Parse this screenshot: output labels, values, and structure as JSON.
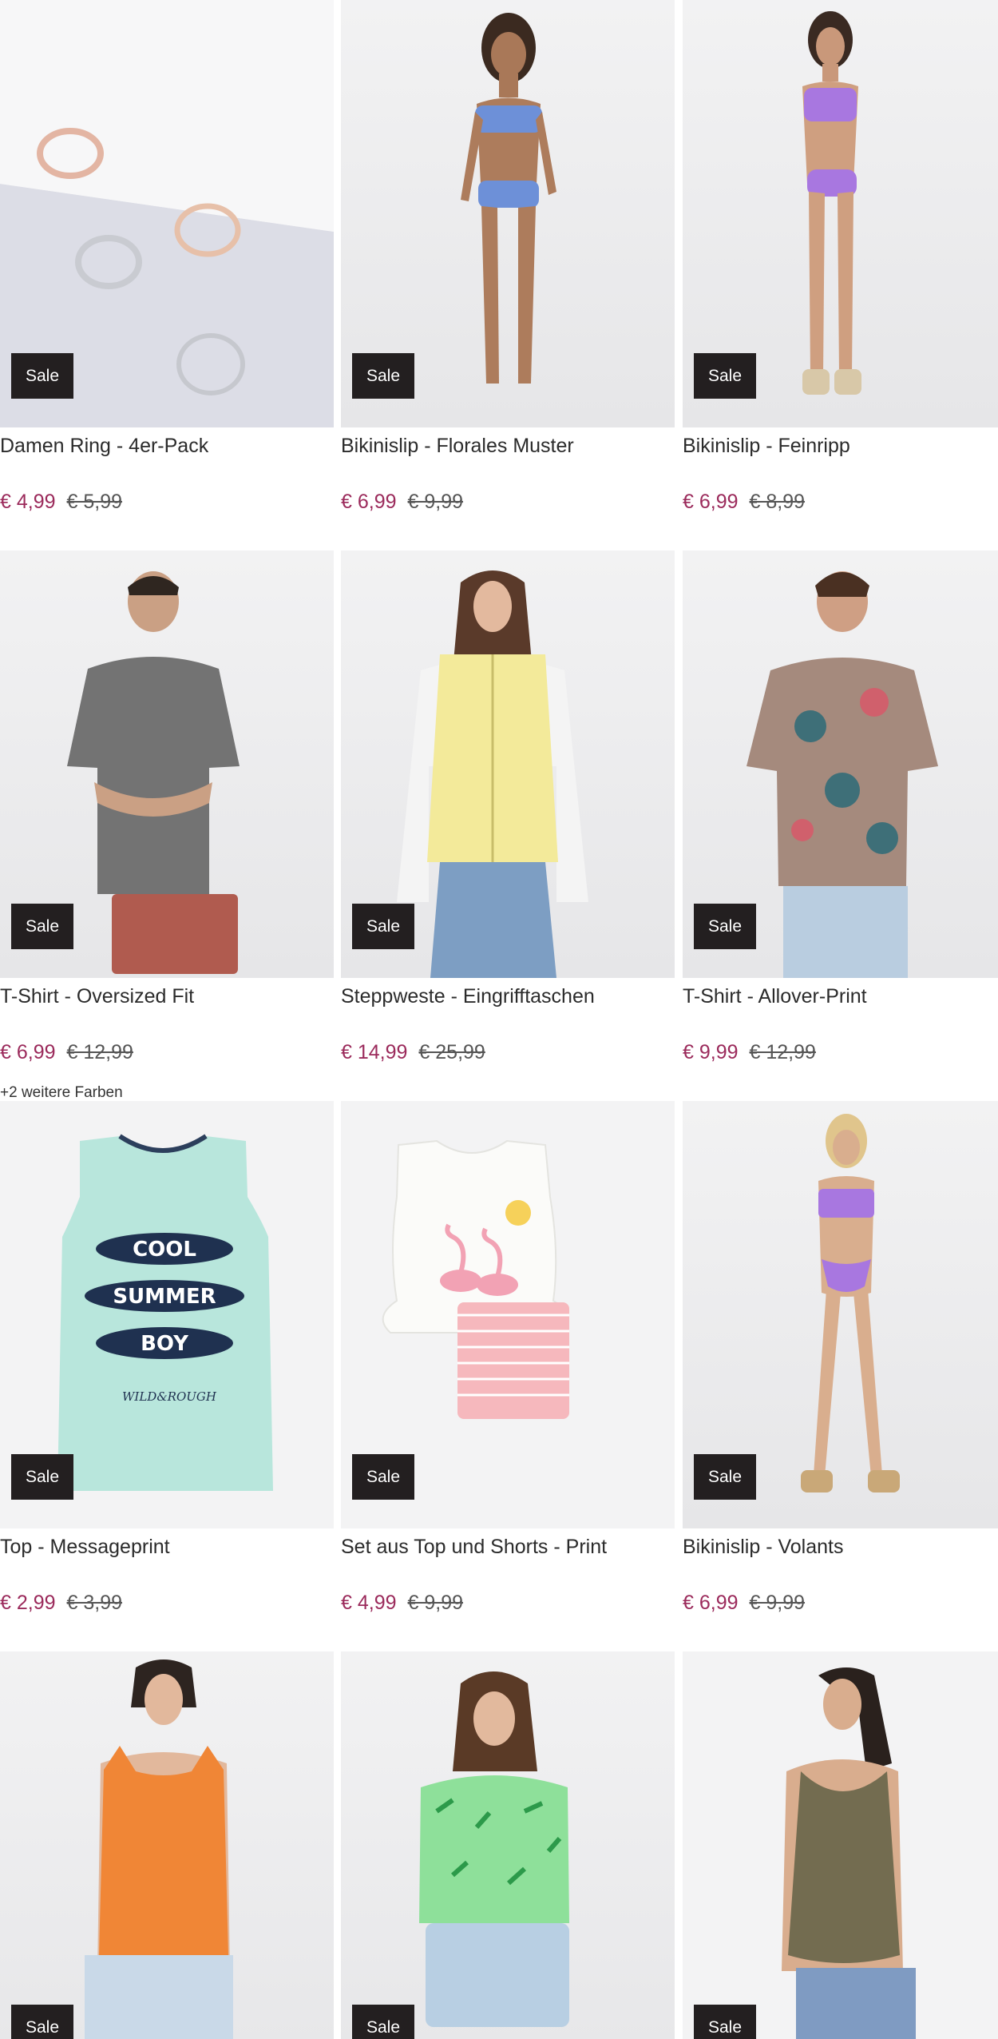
{
  "products": [
    {
      "title": "Damen Ring - 4er-Pack",
      "price": "€ 4,99",
      "old_price": "€ 5,99",
      "badge": "Sale",
      "image": "rings-image"
    },
    {
      "title": "Bikinislip - Florales Muster",
      "price": "€ 6,99",
      "old_price": "€ 9,99",
      "badge": "Sale",
      "image": "floral-bikini-model-image"
    },
    {
      "title": "Bikinislip - Feinripp",
      "price": "€ 6,99",
      "old_price": "€ 8,99",
      "badge": "Sale",
      "image": "lilac-bikini-model-image"
    },
    {
      "title": "T-Shirt - Oversized Fit",
      "price": "€ 6,99",
      "old_price": "€ 12,99",
      "badge": "Sale",
      "extra": "+2 weitere Farben",
      "image": "grey-tshirt-model-image"
    },
    {
      "title": "Steppweste - Eingrifftaschen",
      "price": "€ 14,99",
      "old_price": "€ 25,99",
      "badge": "Sale",
      "image": "yellow-vest-model-image"
    },
    {
      "title": "T-Shirt - Allover-Print",
      "price": "€ 9,99",
      "old_price": "€ 12,99",
      "badge": "Sale",
      "image": "print-tshirt-model-image"
    },
    {
      "title": "Top - Messageprint",
      "price": "€ 2,99",
      "old_price": "€ 3,99",
      "badge": "Sale",
      "image": "mint-top-image"
    },
    {
      "title": "Set aus Top und Shorts - Print",
      "price": "€ 4,99",
      "old_price": "€ 9,99",
      "badge": "Sale",
      "image": "flamingo-set-image"
    },
    {
      "title": "Bikinislip - Volants",
      "price": "€ 6,99",
      "old_price": "€ 9,99",
      "badge": "Sale",
      "image": "ruffle-bikini-model-image"
    },
    {
      "title": "",
      "price": "",
      "old_price": "",
      "badge": "Sale",
      "image": "orange-top-model-image"
    },
    {
      "title": "",
      "price": "",
      "old_price": "",
      "badge": "Sale",
      "image": "green-tshirt-model-image"
    },
    {
      "title": "",
      "price": "",
      "old_price": "",
      "badge": "Sale",
      "image": "olive-top-model-image"
    }
  ],
  "colors": {
    "sale_badge": "#231f20",
    "price": "#9b2a5b",
    "old_price": "#555555"
  },
  "tank_print": {
    "line1": "COOL",
    "line2": "SUMMER",
    "line3": "BOY",
    "brand": "WILD&ROUGH"
  }
}
